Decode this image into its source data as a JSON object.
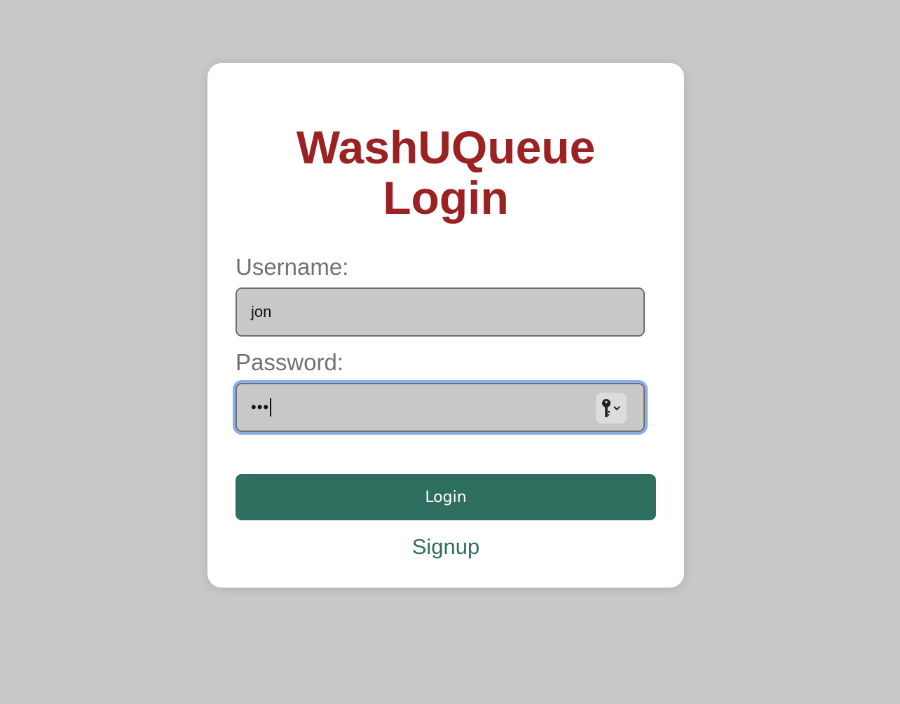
{
  "page": {
    "title_line1": "WashUQueue",
    "title_line2": "Login"
  },
  "form": {
    "username_label": "Username:",
    "username_value": "jon",
    "password_label": "Password:",
    "password_masked": "•••",
    "password_manager_icon": "key-icon",
    "login_label": "Login",
    "signup_label": "Signup"
  },
  "colors": {
    "background": "#c8c8c8",
    "title": "#9b2222",
    "accent": "#2e6f5f",
    "label": "#6f7370",
    "focus_ring": "#8aaee8"
  }
}
